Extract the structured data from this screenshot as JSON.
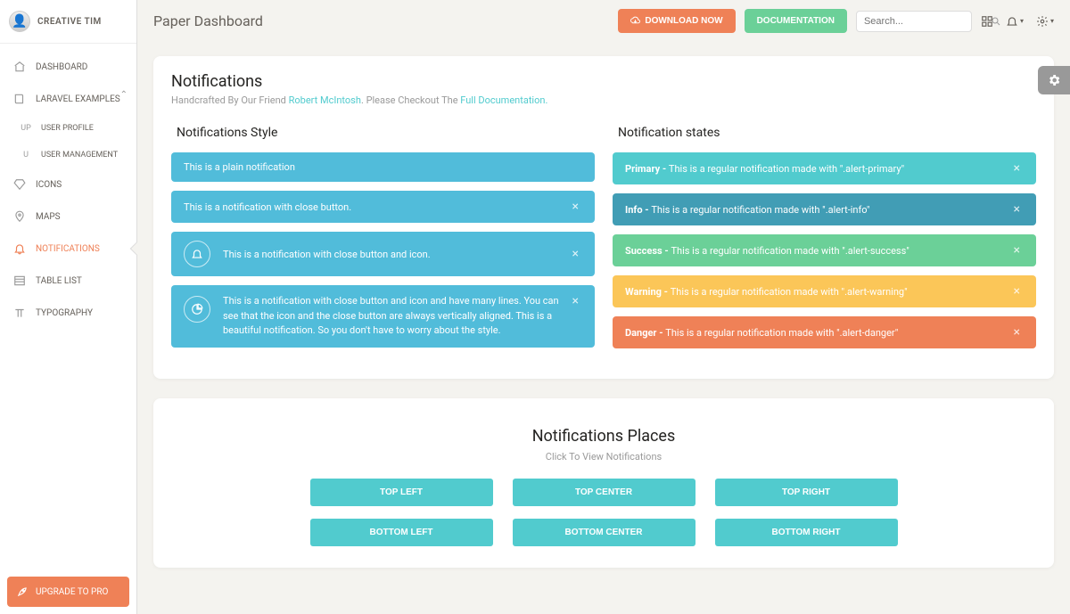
{
  "brand": {
    "name": "CREATIVE TIM"
  },
  "sidebar": {
    "items": [
      {
        "label": "DASHBOARD"
      },
      {
        "label": "LARAVEL EXAMPLES"
      },
      {
        "label": "USER PROFILE",
        "mini": "UP"
      },
      {
        "label": "USER MANAGEMENT",
        "mini": "U"
      },
      {
        "label": "ICONS"
      },
      {
        "label": "MAPS"
      },
      {
        "label": "NOTIFICATIONS"
      },
      {
        "label": "TABLE LIST"
      },
      {
        "label": "TYPOGRAPHY"
      }
    ],
    "upgrade": "UPGRADE TO PRO"
  },
  "topbar": {
    "title": "Paper Dashboard",
    "download": "DOWNLOAD NOW",
    "docs": "DOCUMENTATION",
    "search_placeholder": "Search..."
  },
  "header": {
    "title": "Notifications",
    "sub_prefix": "Handcrafted By Our Friend ",
    "sub_link1": "Robert McIntosh",
    "sub_mid": ". Please Checkout The ",
    "sub_link2": "Full Documentation."
  },
  "cols": {
    "left_title": "Notifications Style",
    "right_title": "Notification states"
  },
  "style_alerts": {
    "a1": "This is a plain notification",
    "a2": "This is a notification with close button.",
    "a3": "This is a notification with close button and icon.",
    "a4": "This is a notification with close button and icon and have many lines. You can see that the icon and the close button are always vertically aligned. This is a beautiful notification. So you don't have to worry about the style."
  },
  "state_alerts": {
    "primary": {
      "bold": "Primary - ",
      "text": "This is a regular notification made with \".alert-primary\""
    },
    "info": {
      "bold": "Info - ",
      "text": "This is a regular notification made with \".alert-info\""
    },
    "success": {
      "bold": "Success - ",
      "text": "This is a regular notification made with \".alert-success\""
    },
    "warning": {
      "bold": "Warning - ",
      "text": "This is a regular notification made with \".alert-warning\""
    },
    "danger": {
      "bold": "Danger - ",
      "text": "This is a regular notification made with \".alert-danger\""
    }
  },
  "places": {
    "title": "Notifications Places",
    "sub": "Click To View Notifications",
    "buttons": {
      "tl": "TOP LEFT",
      "tc": "TOP CENTER",
      "tr": "TOP RIGHT",
      "bl": "BOTTOM LEFT",
      "bc": "BOTTOM CENTER",
      "br": "BOTTOM RIGHT"
    }
  },
  "colors": {
    "accent": "#ef8157",
    "teal": "#51cbce"
  }
}
